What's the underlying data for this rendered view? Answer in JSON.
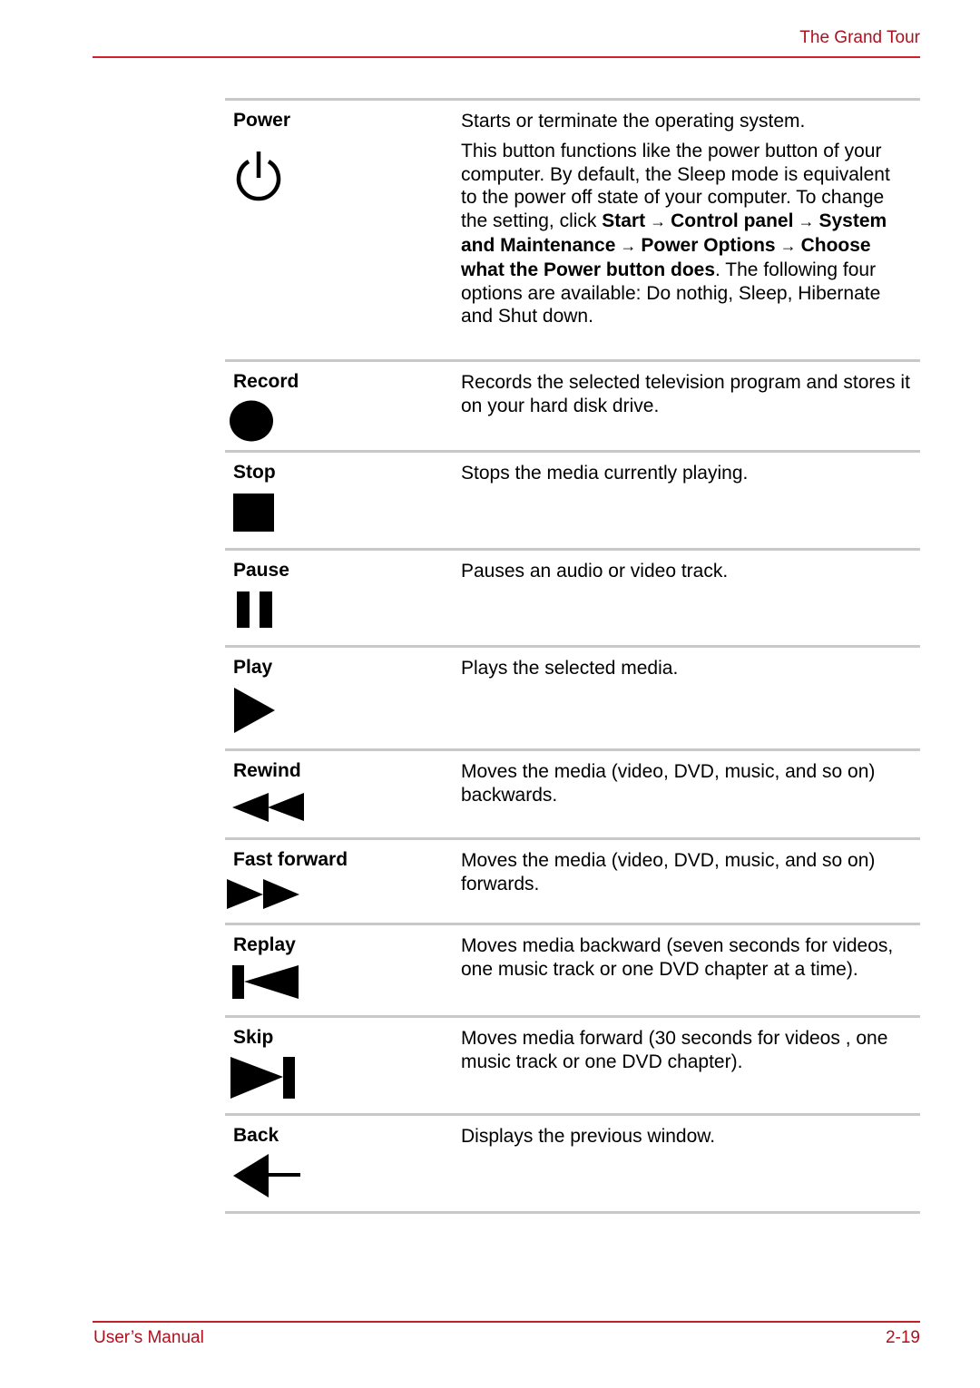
{
  "header": {
    "title": "The Grand Tour"
  },
  "footer": {
    "left": "User’s Manual",
    "page_number": "2-19"
  },
  "colors": {
    "accent": "#b0101e",
    "rule": "#c8c8c8"
  },
  "rows": [
    {
      "term": "Power",
      "icon": "power-icon",
      "desc1": "Starts or terminate the operating system.",
      "desc2_parts": {
        "p1": "This button functions like the power button of your computer. By default, the Sleep mode is equivalent to the power off state of your computer. To change the setting, click ",
        "b1": "Start",
        "a1": " → ",
        "b2": "Control panel",
        "a2": " → ",
        "b3": "System and Maintenance",
        "a3": " → ",
        "b4": "Power Options",
        "a4": " → ",
        "b5": "Choose what the Power button does",
        "p2": ". The following four options are available: Do nothig, Sleep, Hibernate and Shut down."
      }
    },
    {
      "term": "Record",
      "icon": "record-icon",
      "desc": "Records the selected television program and stores it on your hard disk drive."
    },
    {
      "term": "Stop",
      "icon": "stop-icon",
      "desc": "Stops the media currently playing."
    },
    {
      "term": "Pause",
      "icon": "pause-icon",
      "desc": "Pauses an audio or video track."
    },
    {
      "term": "Play",
      "icon": "play-icon",
      "desc": "Plays the selected media."
    },
    {
      "term": "Rewind",
      "icon": "rewind-icon",
      "desc": "Moves the media (video, DVD, music, and so on) backwards."
    },
    {
      "term": "Fast forward",
      "icon": "fast-forward-icon",
      "desc": "Moves the media (video, DVD, music, and so on) forwards."
    },
    {
      "term": "Replay",
      "icon": "replay-icon",
      "desc": "Moves media backward (seven seconds for videos, one music track or one DVD chapter at a time)."
    },
    {
      "term": "Skip",
      "icon": "skip-icon",
      "desc": "Moves media forward (30 seconds for videos , one music track or one DVD chapter)."
    },
    {
      "term": "Back",
      "icon": "back-arrow-icon",
      "desc": "Displays the previous window."
    }
  ]
}
